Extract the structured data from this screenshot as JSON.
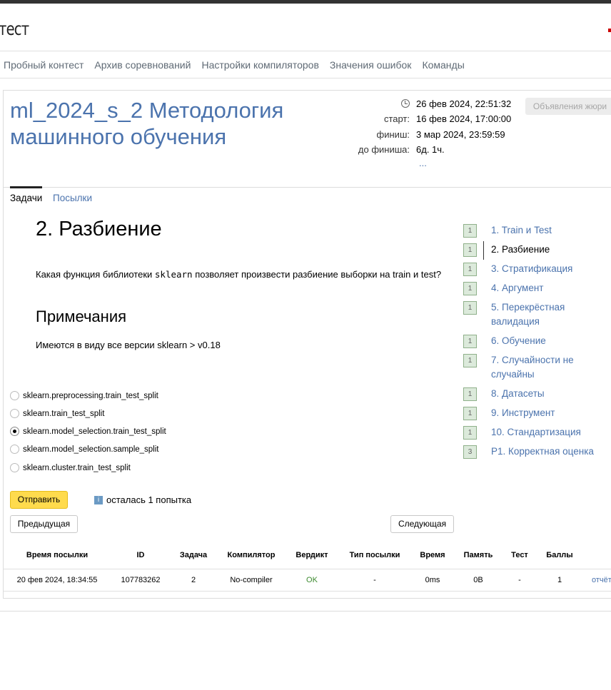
{
  "header": {
    "logo_text": "тест"
  },
  "nav": {
    "items": [
      "Пробный контест",
      "Архив соревнований",
      "Настройки компиляторов",
      "Значения ошибок",
      "Команды"
    ]
  },
  "contest": {
    "title": "ml_2024_s_2 Методология машинного обучения",
    "current_time": "26 фев 2024, 22:51:32",
    "start_label": "старт:",
    "start_value": "16 фев 2024, 17:00:00",
    "finish_label": "финиш:",
    "finish_value": "3 мар 2024, 23:59:59",
    "remaining_label": "до финиша:",
    "remaining_value": "6д. 1ч.",
    "more": "...",
    "jury_button": "Объявления жюри"
  },
  "tabs": [
    "Задачи",
    "Посылки"
  ],
  "problem": {
    "title": "2. Разбиение",
    "text_before": "Какая функция библиотеки ",
    "text_code": "sklearn",
    "text_after": " позволяет произвести разбиение выборки на train и test?",
    "notes_title": "Примечания",
    "notes_text": "Имеются в виду все версии sklearn > v0.18",
    "options": [
      {
        "label": "sklearn.preprocessing.train_test_split",
        "checked": false
      },
      {
        "label": "sklearn.train_test_split",
        "checked": false
      },
      {
        "label": "sklearn.model_selection.train_test_split",
        "checked": true
      },
      {
        "label": "sklearn.model_selection.sample_split",
        "checked": false
      },
      {
        "label": "sklearn.cluster.train_test_split",
        "checked": false
      }
    ],
    "submit_label": "Отправить",
    "info_icon_glyph": "i",
    "attempts_text": "осталась 1 попытка",
    "prev_label": "Предыдущая",
    "next_label": "Следующая"
  },
  "submissions": {
    "headers": [
      "Время посылки",
      "ID",
      "Задача",
      "Компилятор",
      "Вердикт",
      "Тип посылки",
      "Время",
      "Память",
      "Тест",
      "Баллы"
    ],
    "rows": [
      {
        "time": "20 фев 2024, 18:34:55",
        "id": "107783262",
        "task": "2",
        "compiler": "No-compiler",
        "verdict": "OK",
        "type": "-",
        "run_time": "0ms",
        "memory": "0B",
        "test": "-",
        "score": "1",
        "report": "отчёт"
      }
    ]
  },
  "sidebar": {
    "items": [
      {
        "badge": "1",
        "label": "1. Train и Test",
        "active": false
      },
      {
        "badge": "1",
        "label": "2. Разбиение",
        "active": true
      },
      {
        "badge": "1",
        "label": "3. Стратификация",
        "active": false
      },
      {
        "badge": "1",
        "label": "4. Аргумент",
        "active": false
      },
      {
        "badge": "1",
        "label": "5. Перекрёстная валидация",
        "active": false
      },
      {
        "badge": "1",
        "label": "6. Обучение",
        "active": false
      },
      {
        "badge": "1",
        "label": "7. Случайности не случайны",
        "active": false
      },
      {
        "badge": "1",
        "label": "8. Датасеты",
        "active": false
      },
      {
        "badge": "1",
        "label": "9. Инструмент",
        "active": false
      },
      {
        "badge": "1",
        "label": "10. Стандартизация",
        "active": false
      },
      {
        "badge": "3",
        "label": "P1. Корректная оценка",
        "active": false
      }
    ]
  },
  "colors": {
    "link": "#4b73ad",
    "submit_bg": "#ffdb4d",
    "verdict_ok": "#3d8a2f",
    "badge_bg": "#dceadb"
  }
}
